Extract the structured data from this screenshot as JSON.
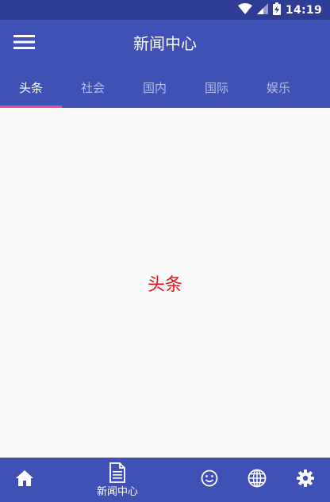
{
  "status_bar": {
    "time": "14:19",
    "icons": [
      "wifi-icon",
      "cell-signal-icon",
      "battery-icon"
    ]
  },
  "app_bar": {
    "title": "新闻中心",
    "menu_icon": "menu-icon"
  },
  "tabs": [
    {
      "label": "头条",
      "active": true
    },
    {
      "label": "社会",
      "active": false
    },
    {
      "label": "国内",
      "active": false
    },
    {
      "label": "国际",
      "active": false
    },
    {
      "label": "娱乐",
      "active": false
    }
  ],
  "content": {
    "text": "头条"
  },
  "bottom_nav": {
    "items": [
      {
        "icon": "home-icon"
      },
      {
        "icon": "news-document-icon",
        "label": "新闻中心",
        "active": true
      },
      {
        "icon": "smiley-icon"
      },
      {
        "icon": "globe-icon"
      },
      {
        "icon": "gear-icon"
      }
    ]
  },
  "colors": {
    "primary": "#3f51b5",
    "status_bar": "#2f3c95",
    "tab_indicator": "#e24d89",
    "content_text": "#e4141a",
    "inactive_tab": "#b4bdea"
  }
}
